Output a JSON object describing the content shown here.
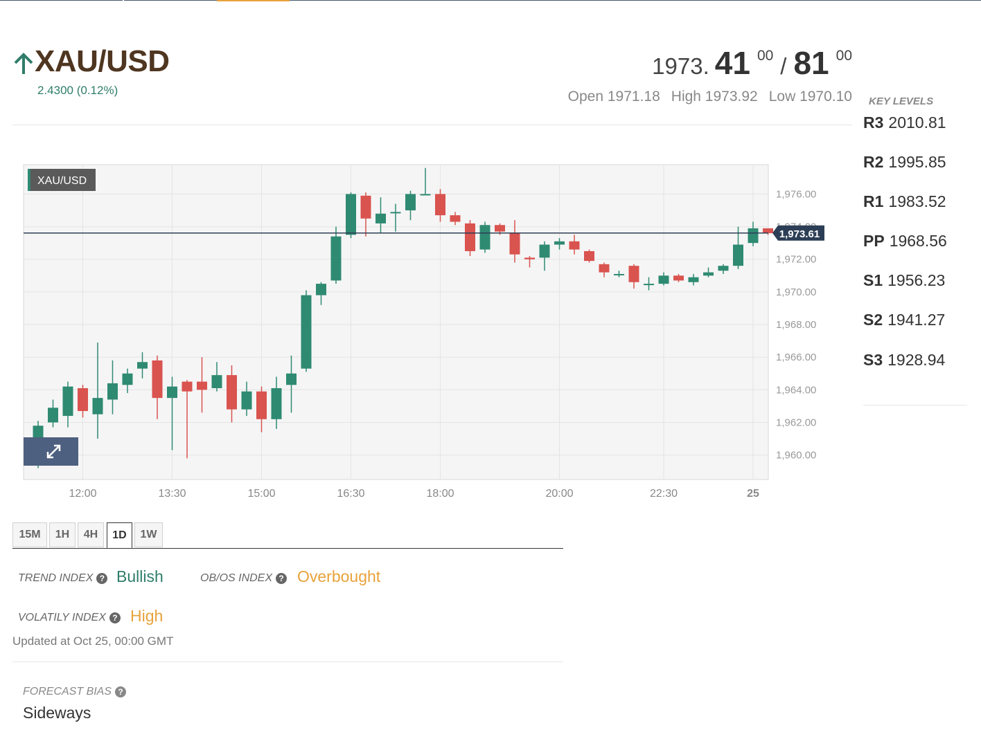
{
  "header": {
    "pair": "XAU/USD",
    "direction_icon": "arrow-up-icon",
    "change": "2.4300 (0.12%)",
    "quote": {
      "bid_prefix": "1973.",
      "bid_big": "41",
      "bid_sup": "00",
      "separator": "/",
      "ask_big": "81",
      "ask_sup": "00"
    },
    "open": "Open 1971.18",
    "high": "High 1973.92",
    "low": "Low 1970.10"
  },
  "key_levels": {
    "title": "KEY LEVELS",
    "levels": [
      {
        "label": "R3",
        "value": "2010.81"
      },
      {
        "label": "R2",
        "value": "1995.85"
      },
      {
        "label": "R1",
        "value": "1983.52"
      },
      {
        "label": "PP",
        "value": "1968.56"
      },
      {
        "label": "S1",
        "value": "1956.23"
      },
      {
        "label": "S2",
        "value": "1941.27"
      },
      {
        "label": "S3",
        "value": "1928.94"
      }
    ]
  },
  "chart_data": {
    "type": "candlestick",
    "symbol_label": "XAU/USD",
    "current_price_label": "1,973.61",
    "current_price": 1973.61,
    "y_ticks": [
      "1,960.00",
      "1,962.00",
      "1,964.00",
      "1,966.00",
      "1,968.00",
      "1,970.00",
      "1,972.00",
      "1,974.00",
      "1,976.00"
    ],
    "y_tick_values": [
      1960,
      1962,
      1964,
      1966,
      1968,
      1970,
      1972,
      1974,
      1976
    ],
    "ylim": [
      1958.5,
      1977.8
    ],
    "x_ticks": [
      "12:00",
      "13:30",
      "15:00",
      "16:30",
      "18:00",
      "20:00",
      "22:30",
      "25"
    ],
    "x_tick_index": [
      3,
      9,
      15,
      21,
      27,
      35,
      42,
      48
    ],
    "grid": true,
    "colors": {
      "up": "#2f8a72",
      "down": "#d9534f",
      "background": "#f5f5f5",
      "grid": "#e4e4e4",
      "price_line": "#2c3e55",
      "expand_button": "#4d6080"
    },
    "candles": [
      {
        "o": 1959.6,
        "h": 1962.1,
        "l": 1959.2,
        "c": 1961.8
      },
      {
        "o": 1962.0,
        "h": 1963.4,
        "l": 1961.7,
        "c": 1962.9
      },
      {
        "o": 1962.4,
        "h": 1964.5,
        "l": 1961.7,
        "c": 1964.2
      },
      {
        "o": 1964.1,
        "h": 1964.3,
        "l": 1962.3,
        "c": 1962.7
      },
      {
        "o": 1962.5,
        "h": 1966.9,
        "l": 1961.0,
        "c": 1963.5
      },
      {
        "o": 1963.4,
        "h": 1965.8,
        "l": 1962.5,
        "c": 1964.4
      },
      {
        "o": 1964.3,
        "h": 1965.3,
        "l": 1963.8,
        "c": 1965.0
      },
      {
        "o": 1965.3,
        "h": 1966.3,
        "l": 1964.7,
        "c": 1965.7
      },
      {
        "o": 1965.8,
        "h": 1966.1,
        "l": 1962.2,
        "c": 1963.5
      },
      {
        "o": 1963.5,
        "h": 1964.8,
        "l": 1960.3,
        "c": 1964.2
      },
      {
        "o": 1964.5,
        "h": 1964.6,
        "l": 1959.8,
        "c": 1963.9
      },
      {
        "o": 1964.5,
        "h": 1966.0,
        "l": 1962.6,
        "c": 1964.0
      },
      {
        "o": 1964.1,
        "h": 1965.7,
        "l": 1963.9,
        "c": 1964.9
      },
      {
        "o": 1964.9,
        "h": 1965.5,
        "l": 1962.0,
        "c": 1962.8
      },
      {
        "o": 1962.8,
        "h": 1964.5,
        "l": 1962.4,
        "c": 1963.9
      },
      {
        "o": 1963.9,
        "h": 1964.2,
        "l": 1961.4,
        "c": 1962.2
      },
      {
        "o": 1962.2,
        "h": 1964.8,
        "l": 1961.6,
        "c": 1964.1
      },
      {
        "o": 1964.3,
        "h": 1966.1,
        "l": 1962.6,
        "c": 1965.0
      },
      {
        "o": 1965.3,
        "h": 1970.1,
        "l": 1965.1,
        "c": 1969.8
      },
      {
        "o": 1969.8,
        "h": 1970.6,
        "l": 1969.2,
        "c": 1970.5
      },
      {
        "o": 1970.7,
        "h": 1974.0,
        "l": 1970.5,
        "c": 1973.4
      },
      {
        "o": 1973.5,
        "h": 1976.1,
        "l": 1973.3,
        "c": 1976.0
      },
      {
        "o": 1975.9,
        "h": 1976.1,
        "l": 1973.4,
        "c": 1974.5
      },
      {
        "o": 1974.2,
        "h": 1975.8,
        "l": 1973.6,
        "c": 1974.8
      },
      {
        "o": 1974.9,
        "h": 1975.4,
        "l": 1973.7,
        "c": 1974.9
      },
      {
        "o": 1975.0,
        "h": 1976.2,
        "l": 1974.4,
        "c": 1976.0
      },
      {
        "o": 1976.0,
        "h": 1977.6,
        "l": 1976.0,
        "c": 1976.0
      },
      {
        "o": 1976.0,
        "h": 1976.3,
        "l": 1974.3,
        "c": 1974.7
      },
      {
        "o": 1974.7,
        "h": 1974.9,
        "l": 1974.1,
        "c": 1974.3
      },
      {
        "o": 1974.2,
        "h": 1974.4,
        "l": 1972.2,
        "c": 1972.5
      },
      {
        "o": 1972.6,
        "h": 1974.3,
        "l": 1972.4,
        "c": 1974.1
      },
      {
        "o": 1974.1,
        "h": 1974.2,
        "l": 1973.5,
        "c": 1973.7
      },
      {
        "o": 1973.6,
        "h": 1974.4,
        "l": 1971.8,
        "c": 1972.3
      },
      {
        "o": 1972.1,
        "h": 1972.2,
        "l": 1971.5,
        "c": 1972.0
      },
      {
        "o": 1972.1,
        "h": 1973.1,
        "l": 1971.3,
        "c": 1972.9
      },
      {
        "o": 1972.9,
        "h": 1973.3,
        "l": 1972.6,
        "c": 1973.1
      },
      {
        "o": 1973.1,
        "h": 1973.5,
        "l": 1972.3,
        "c": 1972.6
      },
      {
        "o": 1972.5,
        "h": 1972.6,
        "l": 1971.8,
        "c": 1971.9
      },
      {
        "o": 1971.7,
        "h": 1971.8,
        "l": 1970.9,
        "c": 1971.2
      },
      {
        "o": 1971.1,
        "h": 1971.3,
        "l": 1970.9,
        "c": 1971.1
      },
      {
        "o": 1971.6,
        "h": 1971.7,
        "l": 1970.2,
        "c": 1970.6
      },
      {
        "o": 1970.5,
        "h": 1970.9,
        "l": 1970.1,
        "c": 1970.5
      },
      {
        "o": 1970.5,
        "h": 1971.2,
        "l": 1970.4,
        "c": 1971.0
      },
      {
        "o": 1971.0,
        "h": 1971.1,
        "l": 1970.6,
        "c": 1970.7
      },
      {
        "o": 1970.6,
        "h": 1971.1,
        "l": 1970.4,
        "c": 1970.9
      },
      {
        "o": 1971.0,
        "h": 1971.5,
        "l": 1970.9,
        "c": 1971.2
      },
      {
        "o": 1971.3,
        "h": 1971.7,
        "l": 1971.1,
        "c": 1971.6
      },
      {
        "o": 1971.6,
        "h": 1974.0,
        "l": 1971.4,
        "c": 1972.9
      },
      {
        "o": 1973.0,
        "h": 1974.3,
        "l": 1972.8,
        "c": 1973.9
      },
      {
        "o": 1973.9,
        "h": 1973.9,
        "l": 1973.5,
        "c": 1973.6
      }
    ]
  },
  "timeframes": {
    "items": [
      "15M",
      "1H",
      "4H",
      "1D",
      "1W"
    ],
    "active": "1D"
  },
  "indicators": {
    "trend_label": "TREND INDEX",
    "trend_value": "Bullish",
    "trend_color": "#2f7d6a",
    "obos_label": "OB/OS INDEX",
    "obos_value": "Overbought",
    "obos_color": "#e8a23a",
    "volatility_label": "VOLATILY INDEX",
    "volatility_value": "High",
    "volatility_color": "#e8a23a",
    "help_icon": "question-circle-icon",
    "updated": "Updated at Oct 25, 00:00 GMT"
  },
  "forecast": {
    "label": "FORECAST BIAS",
    "value": "Sideways"
  }
}
